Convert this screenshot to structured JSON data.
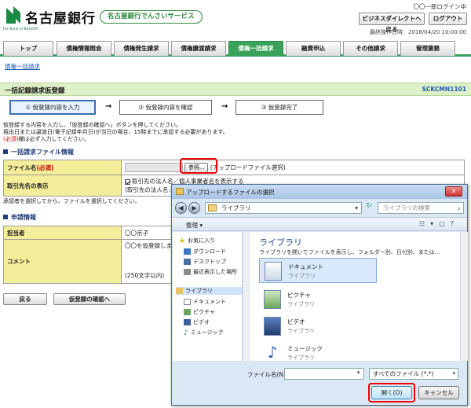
{
  "header": {
    "bank_name": "名古屋銀行",
    "bank_sub": "The Bank of NAGOYA",
    "service_name": "名古屋銀行でんさいサービス",
    "login_user": "〇〇一郎ログイン中",
    "bizdirect_button": "ビジネスダイレクトへ戻る",
    "logout_button": "ログアウト",
    "last_operation": "最終操作日時：2016/04/20 10:00:00"
  },
  "nav": {
    "items": [
      "トップ",
      "債権情報照会",
      "債権発生請求",
      "債権譲渡請求",
      "債権一括請求",
      "融資申込",
      "その他請求",
      "管理業務"
    ],
    "active_index": 4
  },
  "subnav": {
    "link": "債権一括請求"
  },
  "page": {
    "title": "一括記録請求仮登録",
    "screen_id": "SCKCMN1101"
  },
  "steps": [
    "① 仮登録内容を入力",
    "② 仮登録内容を確認",
    "③ 仮登録完了"
  ],
  "instructions": {
    "line1": "仮登録する内容を入力し、「仮登録の確認へ」ボタンを押してください。",
    "line2": "振出日または譲渡日(電子記録年月日)が当日の場合、15時までに承認する必要があります。",
    "line3_req": "(必須)",
    "line3_rest": "欄は必ず入力してください。"
  },
  "file_section": {
    "heading": "一括請求ファイル情報",
    "file_label": "ファイル名",
    "file_req": "(必須)",
    "browse_button": "参照...",
    "browse_note": "(アップロードファイル選択)",
    "display_label": "取引先名の表示",
    "display_check": "取引先の法人名／個人事業者名を表示する",
    "display_note": "(取引先の法人名／",
    "approver_note": "承認者を選択してから、ファイルを選択してください。"
  },
  "request_section": {
    "heading": "申請情報",
    "person_label": "担当者",
    "person_value": "〇〇京子",
    "comment_label": "コメント",
    "comment_value": "〇〇を仮登録しま",
    "comment_limit": "(250文字以内)"
  },
  "bottom_buttons": {
    "back": "戻る",
    "confirm": "仮登録の確認へ"
  },
  "dialog": {
    "title": "アップロードするファイルの選択",
    "close_label": "✕",
    "address": "ライブラリ",
    "search_placeholder": "ライブラリの検索",
    "organize": "整理",
    "left_items": [
      {
        "label": "お気に入り",
        "icon": "star-icon"
      },
      {
        "label": "ダウンロード",
        "icon": "download-folder-icon"
      },
      {
        "label": "デスクトップ",
        "icon": "desktop-icon"
      },
      {
        "label": "最近表示した場所",
        "icon": "recent-places-icon"
      },
      {
        "label": "ライブラリ",
        "icon": "library-icon"
      },
      {
        "label": "ドキュメント",
        "icon": "documents-icon"
      },
      {
        "label": "ピクチャ",
        "icon": "pictures-icon"
      },
      {
        "label": "ビデオ",
        "icon": "videos-icon"
      },
      {
        "label": "ミュージック",
        "icon": "music-icon"
      }
    ],
    "library_title": "ライブラリ",
    "library_desc": "ライブラリを開いてファイルを表示し、フォルダー別、日付別、または...",
    "files": [
      {
        "name": "ドキュメント",
        "type": "ライブラリ",
        "icon": "documents-icon"
      },
      {
        "name": "ピクチャ",
        "type": "ライブラリ",
        "icon": "pictures-icon"
      },
      {
        "name": "ビデオ",
        "type": "ライブラリ",
        "icon": "videos-icon"
      },
      {
        "name": "ミュージック",
        "type": "ライブラリ",
        "icon": "music-icon"
      }
    ],
    "filename_label": "ファイル名(N):",
    "filetype_value": "すべてのファイル (*.*)",
    "open_button": "開く(O)",
    "cancel_button": "キャンセル"
  },
  "colors": {
    "brand_green": "#3aa35a",
    "title_bar": "#dff0c8",
    "label_yellow": "#f4ed9a",
    "highlight_red": "#e00000"
  }
}
